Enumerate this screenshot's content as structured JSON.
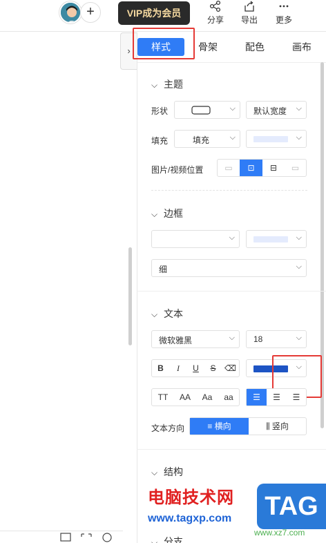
{
  "topbar": {
    "vip_label": "VIP成为会员",
    "share_label": "分享",
    "export_label": "导出",
    "more_label": "更多"
  },
  "panel": {
    "tabs": [
      "样式",
      "骨架",
      "配色",
      "画布"
    ],
    "theme": {
      "title": "主题",
      "shape_label": "形状",
      "width_value": "默认宽度",
      "fill_label": "填充",
      "fill_value": "填充",
      "fill_color": "#e4ebfd",
      "image_pos_label": "图片/视频位置"
    },
    "border": {
      "title": "边框",
      "color": "#e4ebfd",
      "thickness_value": "细"
    },
    "text": {
      "title": "文本",
      "font_value": "微软雅黑",
      "size_value": "18",
      "color": "#1d54c4",
      "case_options": [
        "TT",
        "AA",
        "Aa",
        "aa"
      ],
      "direction_label": "文本方向",
      "horizontal_label": "横向",
      "vertical_label": "竖向"
    },
    "structure": {
      "title": "结构"
    },
    "branch": {
      "title": "分支"
    }
  },
  "watermark": {
    "site_name": "电脑技术网",
    "url": "www.tagxp.com",
    "badge": "TAG",
    "sub_url": "www.xz7.com"
  },
  "colors": {
    "accent": "#2f7cf6",
    "highlight_box": "#e53935"
  }
}
